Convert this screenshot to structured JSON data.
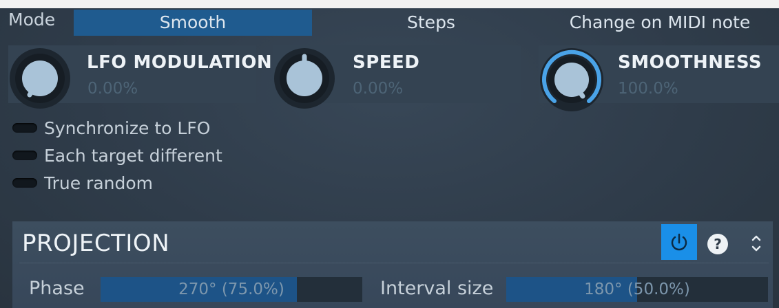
{
  "mode": {
    "label": "Mode",
    "options": [
      "Smooth",
      "Steps",
      "Change on MIDI note"
    ],
    "selected": "Smooth"
  },
  "knobs": [
    {
      "title": "LFO MODULATION",
      "value": "0.00%",
      "fraction": 0.0,
      "color": "#ffffff"
    },
    {
      "title": "SPEED",
      "value": "0.00%",
      "fraction": 0.5,
      "color": "#ffffff"
    },
    {
      "title": "SMOOTHNESS",
      "value": "100.0%",
      "fraction": 1.0,
      "color": "#4aa3e8"
    }
  ],
  "toggles": [
    {
      "label": "Synchronize to LFO",
      "on": false
    },
    {
      "label": "Each target different",
      "on": false
    },
    {
      "label": "True random",
      "on": false
    }
  ],
  "projection": {
    "title": "PROJECTION",
    "help_symbol": "?",
    "phase": {
      "label": "Phase",
      "value": "270° (75.0%)",
      "fraction": 0.75
    },
    "interval": {
      "label": "Interval size",
      "value": "180° (50.0%)",
      "fraction": 0.5
    }
  },
  "colors": {
    "accent": "#1a8fe8",
    "selected_mode": "#1f5b8f",
    "knob_face": "#a9c3d8"
  }
}
